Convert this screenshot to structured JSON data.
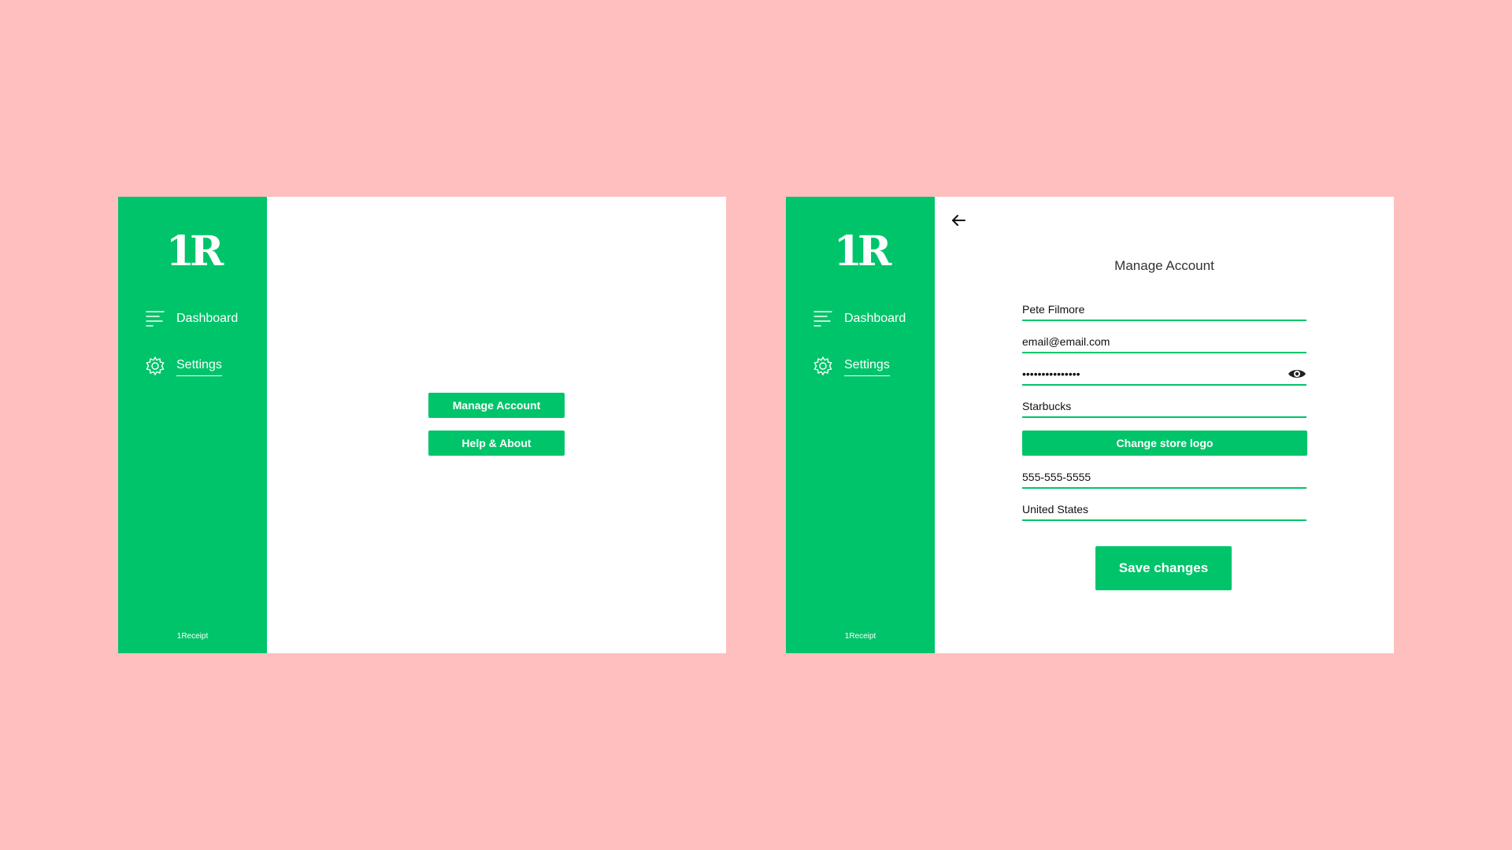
{
  "colors": {
    "background": "#ffbfbf",
    "accent": "#00c46a",
    "panel": "#ffffff"
  },
  "brand": {
    "logo_text": "1R",
    "footer": "1Receipt"
  },
  "sidebar": {
    "items": [
      {
        "label": "Dashboard",
        "icon": "menu-lines-icon"
      },
      {
        "label": "Settings",
        "icon": "gear-icon",
        "active": true
      }
    ]
  },
  "settings_screen": {
    "buttons": {
      "manage_account": "Manage Account",
      "help_about": "Help & About"
    }
  },
  "manage_account_screen": {
    "title": "Manage Account",
    "fields": {
      "name": "Pete Filmore",
      "email": "email@email.com",
      "password": "•••••••••••••••",
      "store": "Starbucks",
      "phone": "555-555-5555",
      "country": "United States"
    },
    "change_logo_label": "Change store logo",
    "save_label": "Save changes"
  }
}
